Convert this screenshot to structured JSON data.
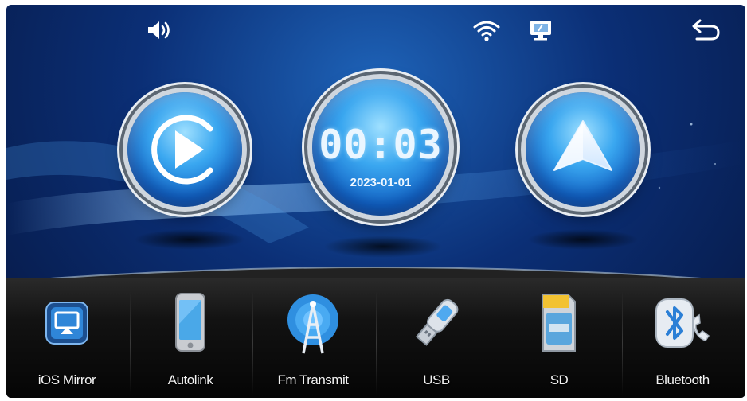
{
  "status_bar": {
    "volume_icon": "speaker-volume-icon",
    "wifi_icon": "wifi-icon",
    "screen_mirror_icon": "monitor-icon",
    "back_icon": "back-arrow-icon"
  },
  "main_buttons": {
    "play": {
      "icon": "play-icon"
    },
    "clock": {
      "time": "00:03",
      "date": "2023-01-01"
    },
    "navigation": {
      "icon": "navigation-arrow-icon"
    }
  },
  "apps": [
    {
      "label": "iOS Mirror",
      "icon": "ios-mirror-icon"
    },
    {
      "label": "Autolink",
      "icon": "phone-icon"
    },
    {
      "label": "Fm Transmit",
      "icon": "radio-tower-icon"
    },
    {
      "label": "USB",
      "icon": "usb-drive-icon"
    },
    {
      "label": "SD",
      "icon": "sd-card-icon"
    },
    {
      "label": "Bluetooth",
      "icon": "bluetooth-icon"
    }
  ],
  "colors": {
    "background_deep": "#06163f",
    "background_light": "#1e63b8",
    "orb_blue": "#3aa7f0",
    "dock_black": "#121212",
    "label_white": "#f2f2f2"
  }
}
